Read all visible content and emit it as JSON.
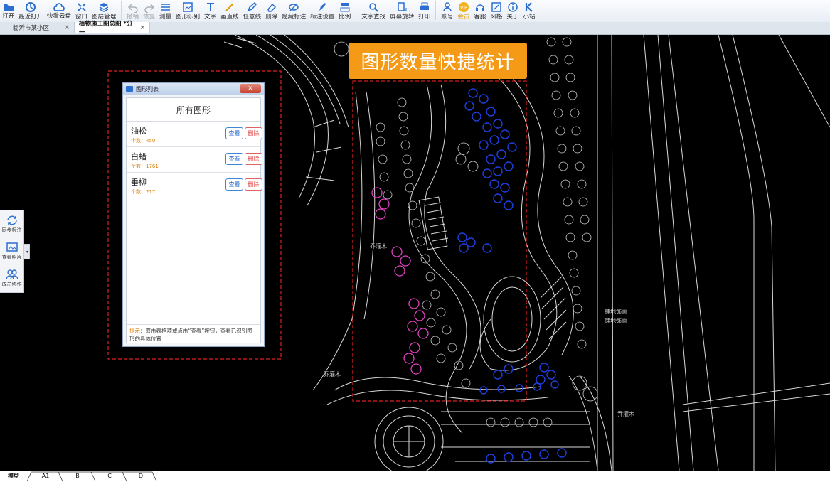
{
  "toolbar": {
    "items": [
      {
        "label": "打开",
        "icon": "folder-icon"
      },
      {
        "label": "最近打开",
        "icon": "clock-icon"
      },
      {
        "label": "快看云盘",
        "icon": "cloud-icon"
      },
      {
        "label": "窗口",
        "icon": "window-icon"
      },
      {
        "label": "图层管理",
        "icon": "layers-icon"
      },
      {
        "label": "撤销",
        "icon": "undo-icon"
      },
      {
        "label": "恢复",
        "icon": "redo-icon"
      },
      {
        "label": "测量",
        "icon": "ruler-icon"
      },
      {
        "label": "图形识别",
        "icon": "image-recognize-icon"
      },
      {
        "label": "文字",
        "icon": "text-icon"
      },
      {
        "label": "画直线",
        "icon": "line-icon"
      },
      {
        "label": "任意线",
        "icon": "pen-icon"
      },
      {
        "label": "删除",
        "icon": "eraser-icon"
      },
      {
        "label": "隐藏标注",
        "icon": "hide-annotation-icon"
      },
      {
        "label": "标注设置",
        "icon": "annotation-settings-icon"
      },
      {
        "label": "比例",
        "icon": "scale-icon"
      },
      {
        "label": "文字查找",
        "icon": "text-search-icon"
      },
      {
        "label": "屏幕旋转",
        "icon": "rotate-screen-icon"
      },
      {
        "label": "打印",
        "icon": "print-icon"
      },
      {
        "label": "账号",
        "icon": "user-icon"
      },
      {
        "label": "会员",
        "icon": "vip-icon"
      },
      {
        "label": "客服",
        "icon": "headset-icon"
      },
      {
        "label": "风格",
        "icon": "style-icon"
      },
      {
        "label": "关于",
        "icon": "info-icon"
      },
      {
        "label": "小站",
        "icon": "k-logo-icon"
      }
    ]
  },
  "tabs": [
    {
      "label": "临沂市某小区",
      "close": "×"
    },
    {
      "label": "植物施工图总图 *分一",
      "close": "×"
    }
  ],
  "banner": {
    "text": "图形数量快捷统计"
  },
  "dialog": {
    "title": "图形列表",
    "close": "✕",
    "heading": "所有图形",
    "rows": [
      {
        "name": "油松",
        "count": "个数：450",
        "view": "查看",
        "delete": "删除"
      },
      {
        "name": "白蜡",
        "count": "个数：1761",
        "view": "查看",
        "delete": "删除"
      },
      {
        "name": "垂柳",
        "count": "个数：217",
        "view": "查看",
        "delete": "删除"
      }
    ],
    "tip_label": "提示",
    "tip_text": "：双击表格项或点击“查看”按钮，查看已识别图形的具体位置"
  },
  "side_panel": {
    "items": [
      {
        "label": "同步标注",
        "icon": "sync-icon"
      },
      {
        "label": "查看照片",
        "icon": "photo-icon"
      },
      {
        "label": "成员协作",
        "icon": "members-icon"
      }
    ],
    "collapse": "◂"
  },
  "layout_tabs": [
    "模型",
    "A1",
    "B",
    "C",
    "D"
  ],
  "colors": {
    "banner": "#f59a16",
    "cad_blue": "#1e3fd8",
    "cad_pink": "#e040c0",
    "dashed_box": "#e02020"
  }
}
